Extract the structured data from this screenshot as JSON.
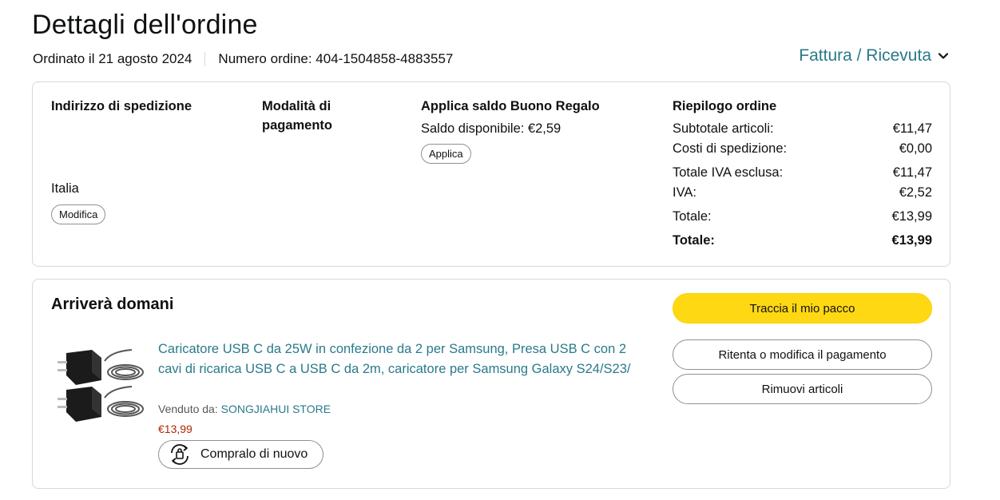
{
  "header": {
    "title": "Dettagli dell'ordine",
    "ordered_on": "Ordinato il 21 agosto 2024",
    "order_number": "Numero ordine: 404-1504858-4883557",
    "invoice_link": "Fattura / Ricevuta"
  },
  "shipping": {
    "heading": "Indirizzo di spedizione",
    "country": "Italia",
    "edit_label": "Modifica"
  },
  "payment": {
    "heading_line1": "Modalità di",
    "heading_line2": "pagamento"
  },
  "gift_card": {
    "heading": "Applica saldo Buono Regalo",
    "balance": "Saldo disponibile: €2,59",
    "apply_label": "Applica"
  },
  "summary": {
    "heading": "Riepilogo ordine",
    "rows": [
      {
        "label": "Subtotale articoli:",
        "value": "€11,47"
      },
      {
        "label": "Costi di spedizione:",
        "value": "€0,00"
      },
      {
        "label": "Totale IVA esclusa:",
        "value": "€11,47"
      },
      {
        "label": "IVA:",
        "value": "€2,52"
      },
      {
        "label": "Totale:",
        "value": "€13,99"
      },
      {
        "label": "Totale:",
        "value": "€13,99"
      }
    ]
  },
  "shipment": {
    "status": "Arriverà domani",
    "product_title": "Caricatore USB C da 25W in confezione da 2 per Samsung, Presa USB C con 2 cavi di ricarica USB C a USB C da 2m, caricatore per Samsung Galaxy S24/S23/",
    "sold_by_label": "Venduto da:",
    "seller": "SONGJIAHUI STORE",
    "price": "€13,99",
    "buy_again_label": "Compralo di nuovo",
    "track_label": "Traccia il mio pacco",
    "retry_payment_label": "Ritenta o modifica il pagamento",
    "remove_items_label": "Rimuovi articoli"
  },
  "colors": {
    "link": "#2a7a8a",
    "primary_button": "#ffd814",
    "price": "#b12704",
    "border": "#d5d9d9"
  },
  "icons": {
    "invoice_dropdown": "chevron-down-icon",
    "buy_again": "rebuy-icon"
  }
}
